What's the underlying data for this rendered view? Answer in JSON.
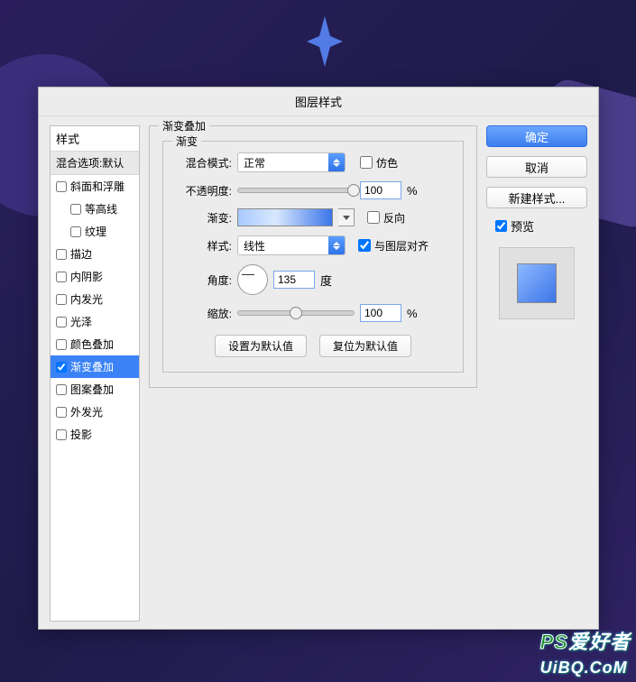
{
  "dialog": {
    "title": "图层样式",
    "sidebar": {
      "header": "样式",
      "blending": "混合选项:默认",
      "items": [
        {
          "label": "斜面和浮雕",
          "checked": false,
          "indent": false
        },
        {
          "label": "等高线",
          "checked": false,
          "indent": true
        },
        {
          "label": "纹理",
          "checked": false,
          "indent": true
        },
        {
          "label": "描边",
          "checked": false,
          "indent": false
        },
        {
          "label": "内阴影",
          "checked": false,
          "indent": false
        },
        {
          "label": "内发光",
          "checked": false,
          "indent": false
        },
        {
          "label": "光泽",
          "checked": false,
          "indent": false
        },
        {
          "label": "颜色叠加",
          "checked": false,
          "indent": false
        },
        {
          "label": "渐变叠加",
          "checked": true,
          "indent": false,
          "selected": true
        },
        {
          "label": "图案叠加",
          "checked": false,
          "indent": false
        },
        {
          "label": "外发光",
          "checked": false,
          "indent": false
        },
        {
          "label": "投影",
          "checked": false,
          "indent": false
        }
      ]
    },
    "panel": {
      "group_title": "渐变叠加",
      "inner_title": "渐变",
      "blend_mode_label": "混合模式:",
      "blend_mode_value": "正常",
      "dither_label": "仿色",
      "dither_checked": false,
      "opacity_label": "不透明度:",
      "opacity_value": "100",
      "opacity_unit": "%",
      "gradient_label": "渐变:",
      "reverse_label": "反向",
      "reverse_checked": false,
      "style_label": "样式:",
      "style_value": "线性",
      "align_label": "与图层对齐",
      "align_checked": true,
      "angle_label": "角度:",
      "angle_value": "135",
      "angle_unit": "度",
      "scale_label": "缩放:",
      "scale_value": "100",
      "scale_unit": "%",
      "make_default": "设置为默认值",
      "reset_default": "复位为默认值"
    },
    "buttons": {
      "ok": "确定",
      "cancel": "取消",
      "new_style": "新建样式...",
      "preview_label": "预览",
      "preview_checked": true
    }
  },
  "watermark": {
    "ps": "PS",
    "rest": "爱好者",
    "site": "UiBQ.CoM"
  }
}
